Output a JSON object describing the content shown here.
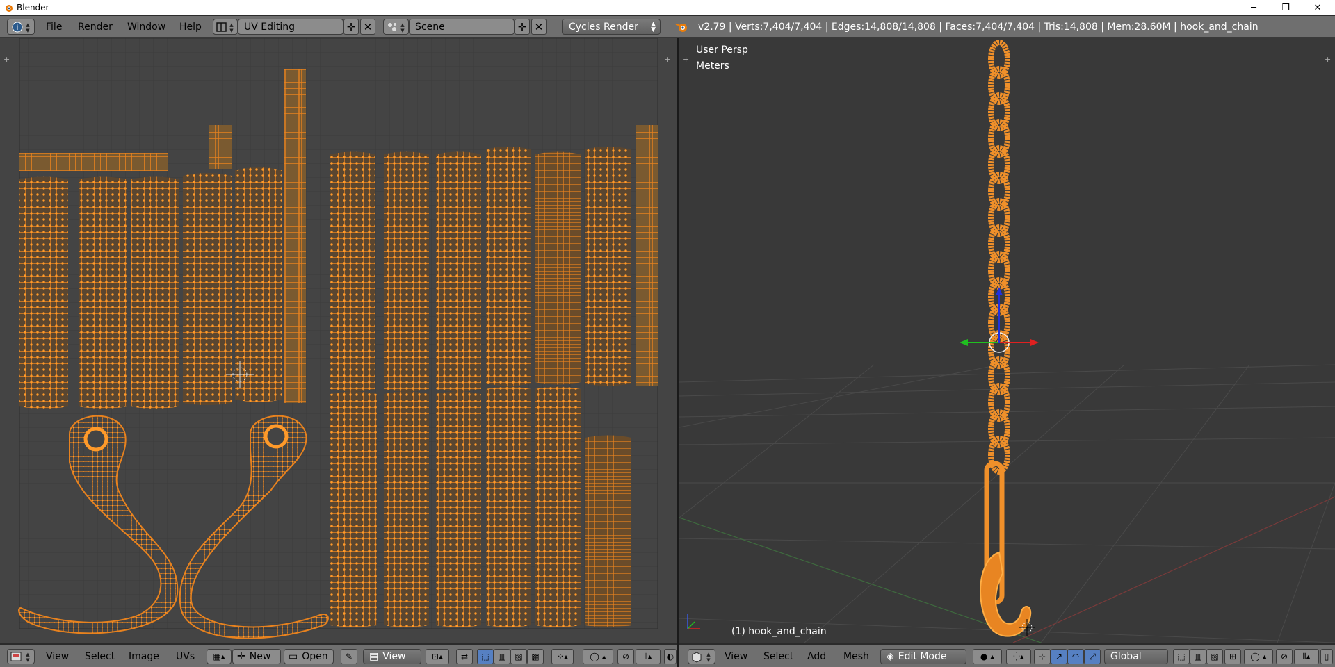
{
  "window": {
    "title": "Blender",
    "minimize_glyph": "─",
    "maximize_glyph": "❐",
    "close_glyph": "✕"
  },
  "topbar": {
    "menu": [
      "File",
      "Render",
      "Window",
      "Help"
    ],
    "screen_layout": "UV Editing",
    "scene": "Scene",
    "render_engine": "Cycles Render",
    "stats": "v2.79 | Verts:7,404/7,404 | Edges:14,808/14,808 | Faces:7,404/7,404 | Tris:14,808 | Mem:28.60M | hook_and_chain"
  },
  "viewport": {
    "view_label": "User Persp",
    "units_label": "Meters",
    "object_label": "(1) hook_and_chain"
  },
  "uv_header": {
    "menu": [
      "View",
      "Select",
      "Image",
      "UVs"
    ],
    "new_label": "New",
    "open_label": "Open",
    "view_dropdown": "View"
  },
  "view3d_header": {
    "menu": [
      "View",
      "Select",
      "Add",
      "Mesh"
    ],
    "mode": "Edit Mode",
    "orientation": "Global"
  },
  "colors": {
    "uv_orange": "#e8821e",
    "selected_orange": "#ff9a1f",
    "ui_gray": "#6f6f6f",
    "editor_bg": "#444444",
    "viewport_bg": "#393939",
    "axis_red": "#e02020",
    "axis_green": "#20c020",
    "axis_blue": "#2020e0"
  },
  "icons": {
    "info_editor": "info-icon",
    "uv_editor": "uv-image-editor-icon",
    "view3d_editor": "3d-view-icon",
    "blender_logo": "blender-logo-icon",
    "engine": "cycles-engine-icon"
  }
}
